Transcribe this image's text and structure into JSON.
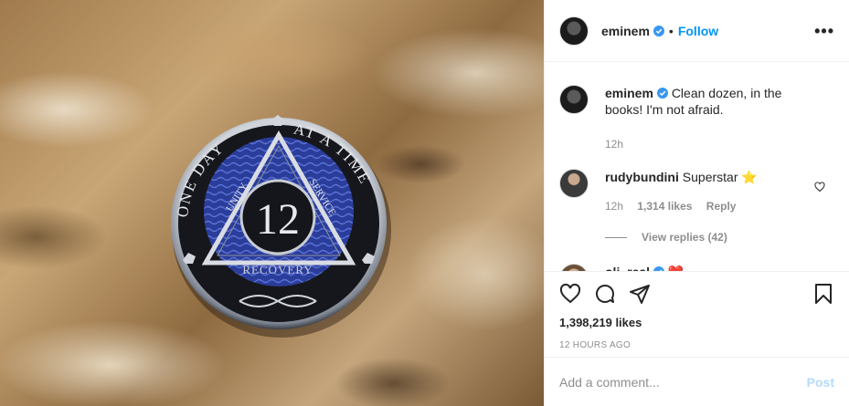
{
  "header": {
    "username": "eminem",
    "separator": "•",
    "follow_label": "Follow",
    "more_label": "•••"
  },
  "photo": {
    "coin": {
      "top_left_text": "ONE DAY",
      "top_right_text": "AT A TIME",
      "left_text": "UNITY",
      "right_text": "SERVICE",
      "center_number": "12",
      "bottom_text": "RECOVERY"
    }
  },
  "caption": {
    "username": "eminem",
    "text": "Clean dozen, in the books! I'm not afraid.",
    "time": "12h"
  },
  "comments": [
    {
      "username": "rudybundini",
      "text": "Superstar",
      "emoji": "⭐",
      "time": "12h",
      "likes": "1,314 likes",
      "reply_label": "Reply",
      "view_replies": "View replies (42)"
    },
    {
      "username": "oli_real",
      "emoji": "❤️"
    }
  ],
  "actions": {
    "likes": "1,398,219 likes",
    "timestamp": "12 HOURS AGO"
  },
  "add_comment": {
    "placeholder": "Add a comment...",
    "post_label": "Post"
  },
  "colors": {
    "link_blue": "#0095f6",
    "post_disabled": "#b3dbff",
    "muted": "#8e8e8e",
    "coin_blue": "#2a3d9a"
  }
}
